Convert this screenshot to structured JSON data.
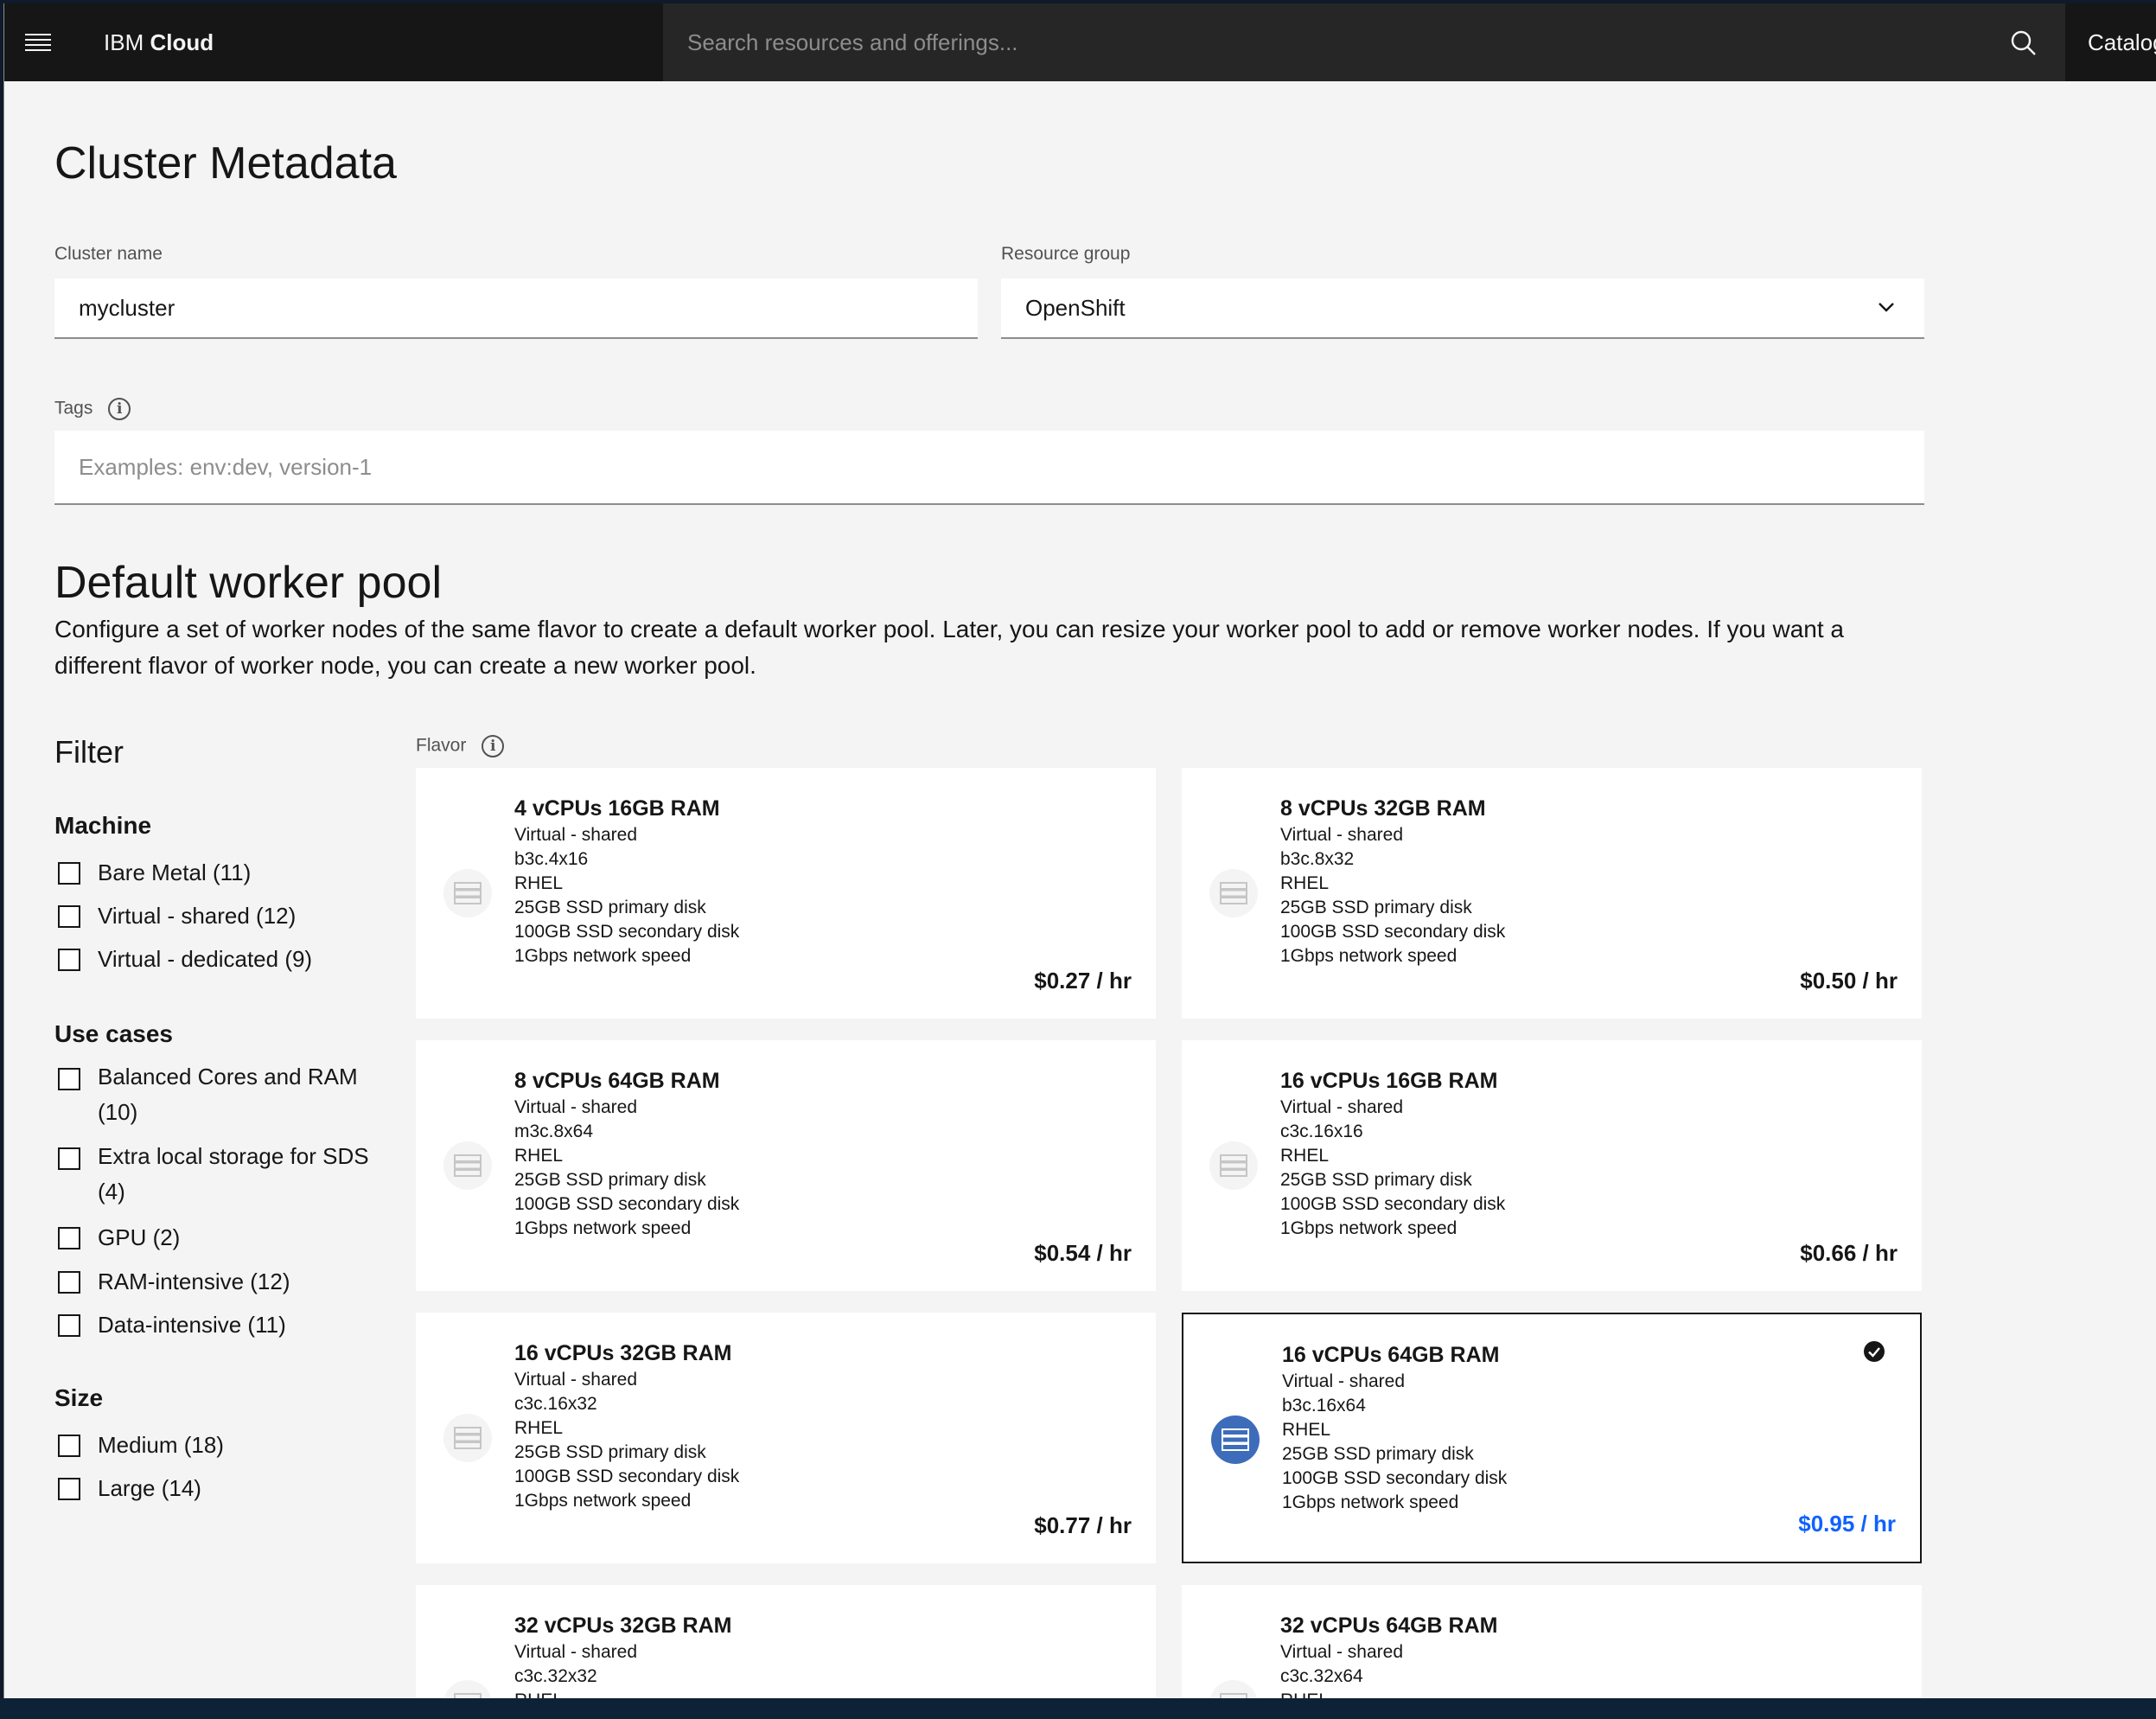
{
  "header": {
    "brand_prefix": "IBM",
    "brand_suffix": "Cloud",
    "search_placeholder": "Search resources and offerings...",
    "catalog_label": "Catalog"
  },
  "cluster_metadata": {
    "title": "Cluster Metadata",
    "cluster_name_label": "Cluster name",
    "cluster_name_value": "mycluster",
    "resource_group_label": "Resource group",
    "resource_group_value": "OpenShift",
    "tags_label": "Tags",
    "tags_placeholder": "Examples: env:dev, version-1"
  },
  "worker_pool": {
    "title": "Default worker pool",
    "description_line1": "Configure a set of worker nodes of the same flavor to create a default worker pool. Later, you can resize your worker pool to add or remove worker nodes. If you want a",
    "description_line2": "different flavor of worker node, you can create a new worker pool."
  },
  "filter": {
    "title": "Filter",
    "groups": [
      {
        "heading": "Machine",
        "options": [
          "Bare Metal (11)",
          "Virtual - shared (12)",
          "Virtual - dedicated (9)"
        ]
      },
      {
        "heading": "Use cases",
        "options": [
          "Balanced Cores and RAM",
          "(10)",
          "Extra local storage for SDS",
          "(4)",
          "GPU (2)",
          "RAM-intensive (12)",
          "Data-intensive (11)"
        ]
      },
      {
        "heading": "Size",
        "options": [
          "Medium (18)",
          "Large (14)"
        ]
      }
    ]
  },
  "flavor": {
    "label": "Flavor",
    "tiles": [
      {
        "title": "4 vCPUs 16GB RAM",
        "type": "Virtual - shared",
        "code": "b3c.4x16",
        "os": "RHEL",
        "primary": "25GB SSD primary disk",
        "secondary": "100GB SSD secondary disk",
        "network": "1Gbps network speed",
        "price": "$0.27 / hr",
        "selected": false
      },
      {
        "title": "8 vCPUs 32GB RAM",
        "type": "Virtual - shared",
        "code": "b3c.8x32",
        "os": "RHEL",
        "primary": "25GB SSD primary disk",
        "secondary": "100GB SSD secondary disk",
        "network": "1Gbps network speed",
        "price": "$0.50 / hr",
        "selected": false
      },
      {
        "title": "8 vCPUs 64GB RAM",
        "type": "Virtual - shared",
        "code": "m3c.8x64",
        "os": "RHEL",
        "primary": "25GB SSD primary disk",
        "secondary": "100GB SSD secondary disk",
        "network": "1Gbps network speed",
        "price": "$0.54 / hr",
        "selected": false
      },
      {
        "title": "16 vCPUs 16GB RAM",
        "type": "Virtual - shared",
        "code": "c3c.16x16",
        "os": "RHEL",
        "primary": "25GB SSD primary disk",
        "secondary": "100GB SSD secondary disk",
        "network": "1Gbps network speed",
        "price": "$0.66 / hr",
        "selected": false
      },
      {
        "title": "16 vCPUs 32GB RAM",
        "type": "Virtual - shared",
        "code": "c3c.16x32",
        "os": "RHEL",
        "primary": "25GB SSD primary disk",
        "secondary": "100GB SSD secondary disk",
        "network": "1Gbps network speed",
        "price": "$0.77 / hr",
        "selected": false
      },
      {
        "title": "16 vCPUs 64GB RAM",
        "type": "Virtual - shared",
        "code": "b3c.16x64",
        "os": "RHEL",
        "primary": "25GB SSD primary disk",
        "secondary": "100GB SSD secondary disk",
        "network": "1Gbps network speed",
        "price": "$0.95 / hr",
        "selected": true
      },
      {
        "title": "32 vCPUs 32GB RAM",
        "type": "Virtual - shared",
        "code": "c3c.32x32",
        "os": "RHEL",
        "primary": "",
        "secondary": "",
        "network": "",
        "price": "",
        "selected": false
      },
      {
        "title": "32 vCPUs 64GB RAM",
        "type": "Virtual - shared",
        "code": "c3c.32x64",
        "os": "RHEL",
        "primary": "",
        "secondary": "",
        "network": "",
        "price": "",
        "selected": false
      }
    ]
  },
  "colors": {
    "header_bg": "#161616",
    "search_bg": "#262626",
    "page_bg": "#f4f4f4",
    "selected_icon_bg": "#3d6cbb",
    "selected_price": "#0f62fe"
  }
}
